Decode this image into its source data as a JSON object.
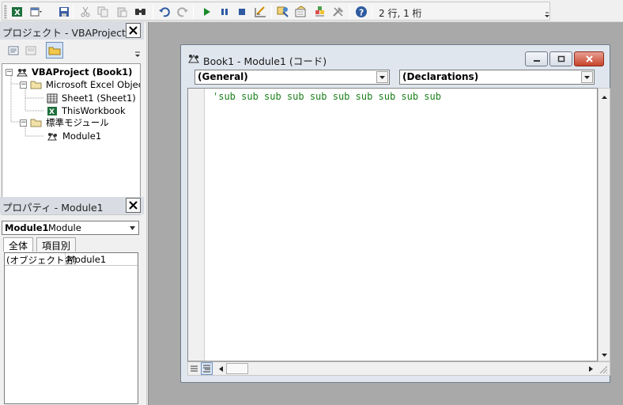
{
  "toolbar": {
    "icons": [
      "excel-view-icon",
      "insert-userform-icon",
      "save-icon",
      "cut-icon",
      "copy-icon",
      "paste-icon",
      "find-icon",
      "undo-icon",
      "redo-icon",
      "run-icon",
      "break-icon",
      "reset-icon",
      "design-mode-icon",
      "project-explorer-icon",
      "properties-window-icon",
      "object-browser-icon",
      "toolbox-icon",
      "help-icon"
    ],
    "cursor_position": "2 行, 1 桁"
  },
  "project_panel": {
    "title": "プロジェクト - VBAProject",
    "tree": {
      "root": "VBAProject (Book1)",
      "folders": [
        {
          "label": "Microsoft Excel Objects",
          "items": [
            "Sheet1 (Sheet1)",
            "ThisWorkbook"
          ]
        },
        {
          "label": "標準モジュール",
          "items": [
            "Module1"
          ]
        }
      ]
    }
  },
  "properties_panel": {
    "title": "プロパティ - Module1",
    "object_name": "Module1",
    "object_type": "Module",
    "tabs": [
      "全体",
      "項目別"
    ],
    "rows": [
      {
        "name": "(オブジェクト名)",
        "value": "Module1"
      }
    ]
  },
  "code_window": {
    "title": "Book1 - Module1 (コード)",
    "object_combo": "(General)",
    "procedure_combo": "(Declarations)",
    "code_lines": [
      "'sub sub sub sub sub sub sub sub sub sub"
    ]
  }
}
